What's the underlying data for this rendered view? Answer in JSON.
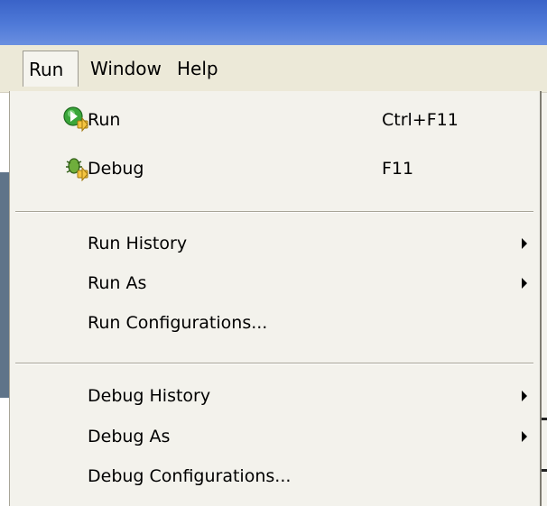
{
  "menubar": {
    "items": [
      {
        "label": "Run"
      },
      {
        "label": "Window"
      },
      {
        "label": "Help"
      }
    ]
  },
  "run_menu": {
    "items": [
      {
        "label": "Run",
        "shortcut": "Ctrl+F11",
        "icon": "run-icon"
      },
      {
        "label": "Debug",
        "shortcut": "F11",
        "icon": "debug-icon"
      },
      {
        "label": "Run History",
        "submenu": true
      },
      {
        "label": "Run As",
        "submenu": true
      },
      {
        "label": "Run Configurations..."
      },
      {
        "label": "Debug History",
        "submenu": true
      },
      {
        "label": "Debug As",
        "submenu": true
      },
      {
        "label": "Debug Configurations..."
      }
    ]
  },
  "colors": {
    "titlebar": "#3a63c8",
    "menu_background": "#f3f2ec",
    "run_icon_green": "#3aa63a",
    "debug_icon_green": "#6fae3c"
  }
}
